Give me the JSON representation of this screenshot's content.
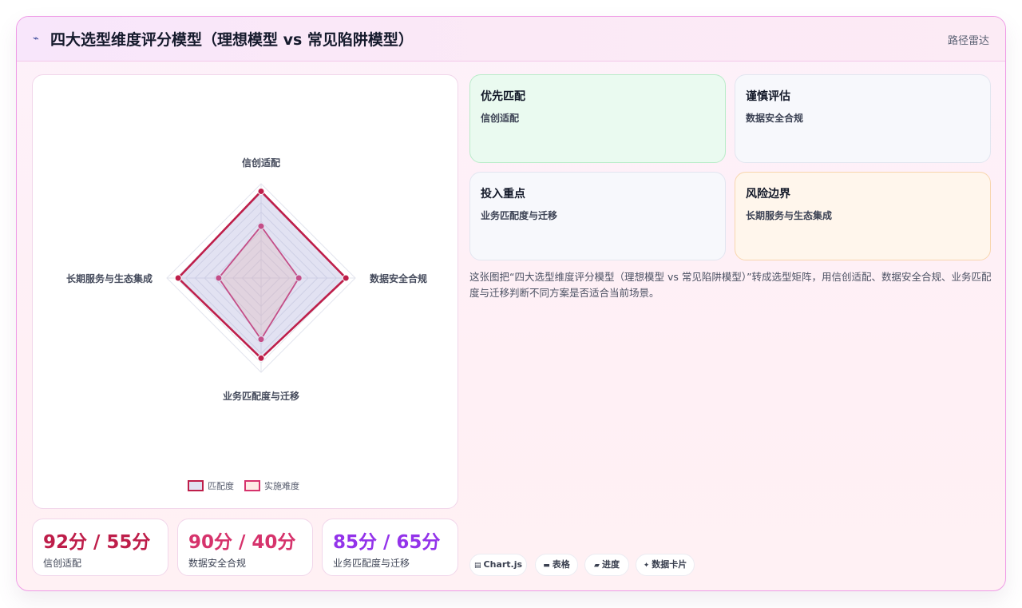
{
  "header": {
    "title": "四大选型维度评分模型（理想模型 vs 常见陷阱模型）",
    "title_icon": "chart-line-icon",
    "right_label": "路径雷达"
  },
  "chart_data": {
    "type": "radar",
    "categories": [
      "信创适配",
      "数据安全合规",
      "业务匹配度与迁移",
      "长期服务与生态集成"
    ],
    "series": [
      {
        "name": "匹配度",
        "values": [
          92,
          90,
          85,
          88
        ],
        "color": "#be1e4a"
      },
      {
        "name": "实施难度",
        "values": [
          55,
          40,
          65,
          45
        ],
        "color": "#d6336c"
      }
    ],
    "r_range": [
      0,
      100
    ],
    "grid": true,
    "legend": "bottom"
  },
  "stats": [
    {
      "value": "92分 / 55分",
      "label": "信创适配",
      "color": "#be1e4a"
    },
    {
      "value": "90分 / 40分",
      "label": "数据安全合规",
      "color": "#d6336c"
    },
    {
      "value": "85分 / 65分",
      "label": "业务匹配度与迁移",
      "color": "#9333ea"
    }
  ],
  "cards": [
    {
      "title": "优先匹配",
      "value": "信创适配",
      "bg": "#eafaf0",
      "border": "#b9ecc9"
    },
    {
      "title": "谨慎评估",
      "value": "数据安全合规",
      "bg": "#f7f8fc",
      "border": "#e2e6f0"
    },
    {
      "title": "投入重点",
      "value": "业务匹配度与迁移",
      "bg": "#f7f8fc",
      "border": "#e2e6f0"
    },
    {
      "title": "风险边界",
      "value": "长期服务与生态集成",
      "bg": "#fff6ec",
      "border": "#f8d6ae"
    }
  ],
  "description": "这张图把“四大选型维度评分模型（理想模型 vs 常见陷阱模型）”转成选型矩阵，用信创适配、数据安全合规、业务匹配度与迁移判断不同方案是否适合当前场景。",
  "tags": [
    {
      "label": "Chart.js",
      "icon": "chart-icon"
    },
    {
      "label": "表格",
      "icon": "table-icon"
    },
    {
      "label": "进度",
      "icon": "progress-icon"
    },
    {
      "label": "数据卡片",
      "icon": "card-icon"
    }
  ]
}
